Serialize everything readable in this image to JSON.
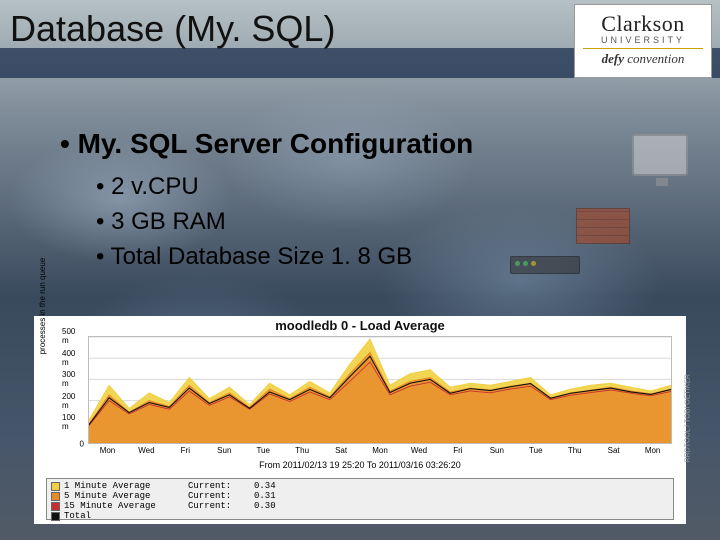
{
  "slide": {
    "title": "Database (My. SQL)",
    "logo": {
      "name": "Clarkson",
      "subtitle": "UNIVERSITY",
      "tagline_prefix": "defy",
      "tagline_suffix": " convention"
    }
  },
  "content": {
    "heading": "My. SQL Server Configuration",
    "bullets": [
      "2 v.CPU",
      "3 GB RAM",
      "Total Database Size 1. 8 GB"
    ]
  },
  "chart_data": {
    "type": "area",
    "title": "moodledb 0 - Load Average",
    "ylabel": "processes in the run queue",
    "xlabel_sub": "From 2011/02/13 19 25:20 To 2011/03/16 03:26:20",
    "credit": "RRDTOOL / TOBI OETIKER",
    "ylim": [
      0,
      550
    ],
    "yticks": [
      0,
      "100 m",
      "200 m",
      "300 m",
      "400 m",
      "500 m"
    ],
    "xticks": [
      "Mon",
      "Wed",
      "Fri",
      "Sun",
      "Tue",
      "Thu",
      "Sat",
      "Mon",
      "Wed",
      "Fri",
      "Sun",
      "Tue",
      "Thu",
      "Sat",
      "Mon"
    ],
    "series": [
      {
        "name": "1 Minute Average",
        "color": "#f0d040",
        "current": 0.34,
        "values": [
          120,
          300,
          180,
          260,
          210,
          340,
          230,
          290,
          200,
          310,
          250,
          320,
          260,
          410,
          540,
          300,
          360,
          380,
          290,
          310,
          300,
          320,
          340,
          250,
          280,
          300,
          310,
          290,
          270,
          300
        ]
      },
      {
        "name": "5 Minute Average",
        "color": "#e88a2a",
        "current": 0.31,
        "values": [
          100,
          250,
          160,
          220,
          190,
          300,
          210,
          260,
          185,
          280,
          230,
          290,
          240,
          360,
          470,
          270,
          320,
          340,
          265,
          285,
          275,
          295,
          310,
          235,
          260,
          275,
          290,
          270,
          255,
          280
        ]
      },
      {
        "name": "15 Minute Average",
        "color": "#c73030",
        "current": 0.3,
        "values": [
          90,
          220,
          150,
          200,
          175,
          270,
          195,
          240,
          175,
          255,
          215,
          265,
          225,
          320,
          420,
          250,
          295,
          315,
          250,
          270,
          260,
          280,
          295,
          225,
          248,
          262,
          275,
          258,
          245,
          268
        ]
      },
      {
        "name": "Total",
        "color": "#111111",
        "current": null,
        "values": [
          95,
          235,
          158,
          210,
          185,
          285,
          205,
          250,
          180,
          265,
          225,
          278,
          235,
          345,
          450,
          262,
          310,
          330,
          258,
          282,
          272,
          292,
          308,
          232,
          258,
          272,
          285,
          265,
          252,
          278
        ]
      }
    ],
    "legend_current_label": "Current:"
  }
}
